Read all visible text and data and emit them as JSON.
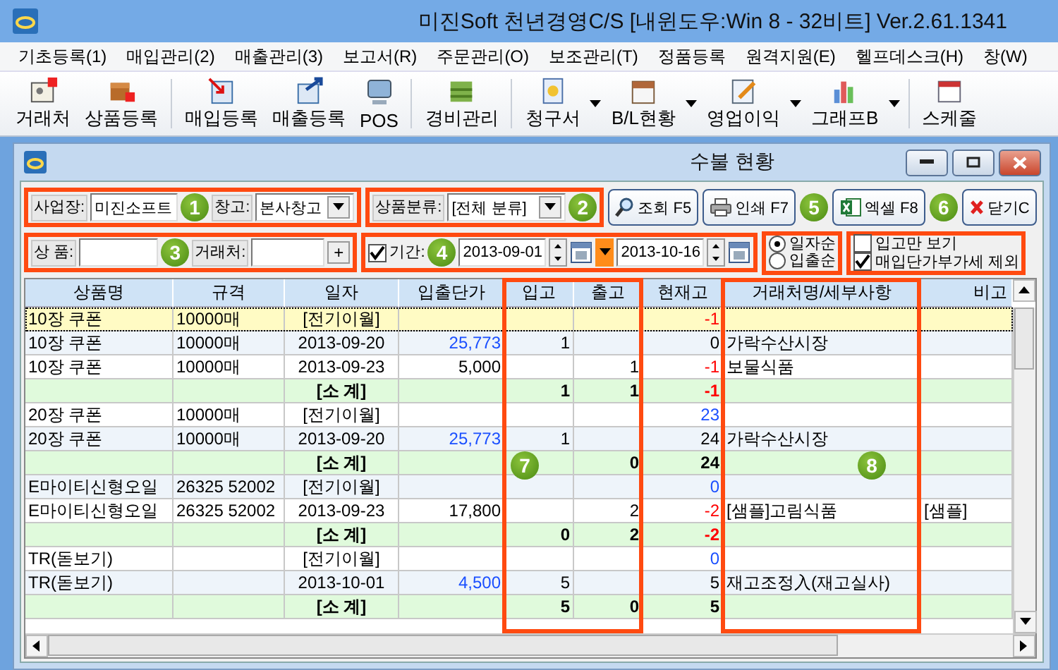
{
  "window": {
    "title": "미진Soft 천년경영C/S [내윈도우:Win 8 - 32비트] Ver.2.61.1341"
  },
  "menu": [
    "기초등록(1)",
    "매입관리(2)",
    "매출관리(3)",
    "보고서(R)",
    "주문관리(O)",
    "보조관리(T)",
    "정품등록",
    "원격지원(E)",
    "헬프데스크(H)",
    "창(W)"
  ],
  "toolbar": [
    {
      "kind": "tool",
      "label": "거래처",
      "dropdown": false
    },
    {
      "kind": "tool",
      "label": "상품등록",
      "dropdown": false
    },
    {
      "kind": "separator"
    },
    {
      "kind": "tool",
      "label": "매입등록",
      "dropdown": false
    },
    {
      "kind": "tool",
      "label": "매출등록",
      "dropdown": false
    },
    {
      "kind": "tool",
      "label": "POS",
      "dropdown": false
    },
    {
      "kind": "separator"
    },
    {
      "kind": "tool",
      "label": "경비관리",
      "dropdown": false
    },
    {
      "kind": "separator"
    },
    {
      "kind": "tool",
      "label": "청구서",
      "dropdown": true
    },
    {
      "kind": "tool",
      "label": "B/L현황",
      "dropdown": true
    },
    {
      "kind": "tool",
      "label": "영업이익",
      "dropdown": true
    },
    {
      "kind": "tool",
      "label": "그래프B",
      "dropdown": true
    },
    {
      "kind": "separator"
    },
    {
      "kind": "tool",
      "label": "스케줄",
      "dropdown": false
    }
  ],
  "child_window": {
    "title": "수불 현황"
  },
  "filters": {
    "business_label": "사업장:",
    "business_value": "미진소프트",
    "warehouse_label": "창고:",
    "warehouse_value": "본사창고",
    "category_label": "상품분류:",
    "category_value": "[전체 분류]",
    "product_label": "상 품:",
    "client_label": "거래처:",
    "client_add": "+",
    "period_checked": true,
    "period_label": "기간:",
    "date_from": "2013-09-01",
    "date_to": "2013-10-16"
  },
  "buttons": [
    "조회 F5",
    "인쇄 F7",
    "엑셀 F8",
    "닫기C"
  ],
  "sort_options": [
    {
      "label": "일자순",
      "selected": true
    },
    {
      "label": "입출순",
      "selected": false
    }
  ],
  "options": [
    {
      "label": "입고만 보기",
      "checked": false
    },
    {
      "label": "매입단가부가세 제외",
      "checked": true
    }
  ],
  "table": {
    "columns": [
      "상품명",
      "규격",
      "일자",
      "입출단가",
      "입고",
      "출고",
      "현재고",
      "거래처명/세부사항",
      "비고"
    ],
    "rows": [
      {
        "kind": "carry",
        "selected": true,
        "name": "10장 쿠폰",
        "spec": "10000매",
        "date": "[전기이월]",
        "stock": {
          "text": "-1",
          "color": "#ff0000"
        }
      },
      {
        "kind": "entry",
        "selected": false,
        "name": "10장 쿠폰",
        "spec": "10000매",
        "date": "2013-09-20",
        "price": {
          "text": "25,773",
          "color": "#1a4fff"
        },
        "in": "1",
        "stock": {
          "text": "0",
          "color": "#000000"
        },
        "client": "가락수산시장"
      },
      {
        "kind": "entry",
        "selected": false,
        "name": "10장 쿠폰",
        "spec": "10000매",
        "date": "2013-09-23",
        "price": {
          "text": "5,000",
          "color": "#000000"
        },
        "out": "1",
        "stock": {
          "text": "-1",
          "color": "#ff0000"
        },
        "client": "보물식품"
      },
      {
        "kind": "subtotal",
        "selected": false,
        "date": "[소 계]",
        "in": "1",
        "out": "1",
        "stock": {
          "text": "-1",
          "color": "#ff0000"
        }
      },
      {
        "kind": "carry",
        "selected": false,
        "name": "20장 쿠폰",
        "spec": "10000매",
        "date": "[전기이월]",
        "stock": {
          "text": "23",
          "color": "#1a4fff"
        }
      },
      {
        "kind": "entry",
        "selected": false,
        "name": "20장 쿠폰",
        "spec": "10000매",
        "date": "2013-09-20",
        "price": {
          "text": "25,773",
          "color": "#1a4fff"
        },
        "in": "1",
        "stock": {
          "text": "24",
          "color": "#000000"
        },
        "client": "가락수산시장"
      },
      {
        "kind": "subtotal",
        "selected": false,
        "date": "[소 계]",
        "out": "0",
        "stock": {
          "text": "24",
          "color": "#000000"
        }
      },
      {
        "kind": "carry",
        "selected": false,
        "name": "E마이티신형오일",
        "spec": "26325 52002",
        "date": "[전기이월]",
        "stock": {
          "text": "0",
          "color": "#1a4fff"
        }
      },
      {
        "kind": "entry",
        "selected": false,
        "name": "E마이티신형오일",
        "spec": "26325 52002",
        "date": "2013-09-23",
        "price": {
          "text": "17,800",
          "color": "#000000"
        },
        "out": "2",
        "stock": {
          "text": "-2",
          "color": "#ff0000"
        },
        "client": "[샘플]고림식품",
        "note": "[샘플]"
      },
      {
        "kind": "subtotal",
        "selected": false,
        "date": "[소 계]",
        "in": "0",
        "out": "2",
        "stock": {
          "text": "-2",
          "color": "#ff0000"
        }
      },
      {
        "kind": "carry",
        "selected": false,
        "name": "TR(돋보기)",
        "date": "[전기이월]",
        "stock": {
          "text": "0",
          "color": "#1a4fff"
        }
      },
      {
        "kind": "entry",
        "selected": false,
        "name": "TR(돋보기)",
        "date": "2013-10-01",
        "price": {
          "text": "4,500",
          "color": "#1a4fff"
        },
        "in": "5",
        "stock": {
          "text": "5",
          "color": "#000000"
        },
        "client": "재고조정入(재고실사)"
      },
      {
        "kind": "subtotal",
        "selected": false,
        "date": "[소 계]",
        "in": "5",
        "out": "0",
        "stock": {
          "text": "5",
          "color": "#000000"
        }
      }
    ]
  },
  "callouts": [
    "1",
    "2",
    "3",
    "4",
    "5",
    "6",
    "7",
    "8"
  ]
}
